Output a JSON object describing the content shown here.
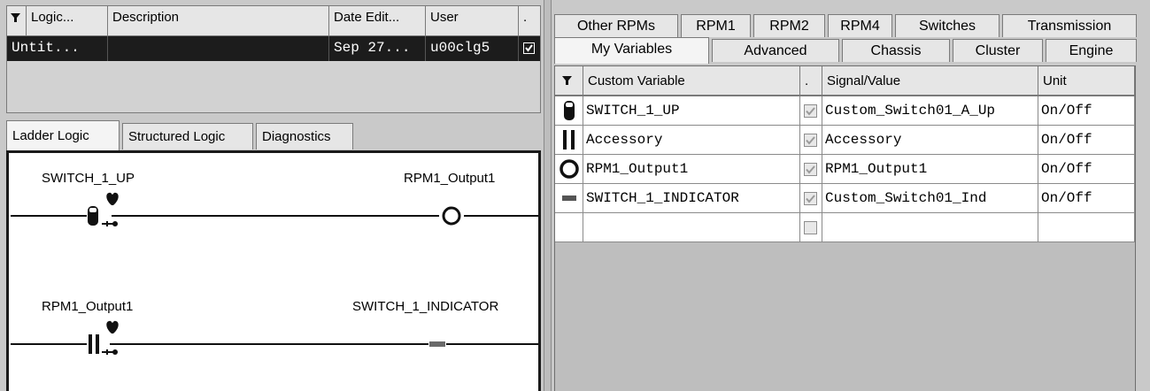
{
  "logic_table": {
    "headers": [
      "Logic...",
      "Description",
      "Date Edit...",
      "User",
      "."
    ],
    "row": {
      "logic": "Untit...",
      "description": "",
      "date": "Sep 27...",
      "user": "u00clg5",
      "checked": true
    }
  },
  "left_tabs": [
    "Ladder Logic",
    "Structured Logic",
    "Diagnostics"
  ],
  "left_active_tab": 0,
  "ladder": {
    "rungs": [
      {
        "input": "SWITCH_1_UP",
        "output": "RPM1_Output1",
        "input_icon": "switch-contact-icon",
        "output_icon": "coil-circle-icon"
      },
      {
        "input": "RPM1_Output1",
        "output": "SWITCH_1_INDICATOR",
        "input_icon": "normally-open-contact-icon",
        "output_icon": "indicator-dash-icon"
      }
    ]
  },
  "right_tabs_back": [
    "Other RPMs",
    "RPM1",
    "RPM2",
    "RPM4",
    "Switches",
    "Transmission"
  ],
  "right_tabs_front": [
    "My Variables",
    "Advanced",
    "Chassis",
    "Cluster",
    "Engine"
  ],
  "right_active_tab": "My Variables",
  "var_table": {
    "headers": [
      "Custom Variable",
      ".",
      "Signal/Value",
      "Unit"
    ],
    "rows": [
      {
        "icon": "switch-contact-icon",
        "name": "SWITCH_1_UP",
        "checked": true,
        "signal": "Custom_Switch01_A_Up",
        "unit": "On/Off"
      },
      {
        "icon": "normally-open-contact-icon",
        "name": "Accessory",
        "checked": true,
        "signal": "Accessory",
        "unit": "On/Off"
      },
      {
        "icon": "coil-circle-icon",
        "name": "RPM1_Output1",
        "checked": true,
        "signal": "RPM1_Output1",
        "unit": "On/Off"
      },
      {
        "icon": "indicator-dash-icon",
        "name": "SWITCH_1_INDICATOR",
        "checked": true,
        "signal": "Custom_Switch01_Ind",
        "unit": "On/Off"
      },
      {
        "icon": "",
        "name": "",
        "checked": false,
        "signal": "",
        "unit": ""
      }
    ]
  },
  "colors": {
    "background": "#c9c9c9",
    "selected_row": "#1c1c1c",
    "header": "#e6e6e6",
    "canvas": "#ffffff"
  }
}
